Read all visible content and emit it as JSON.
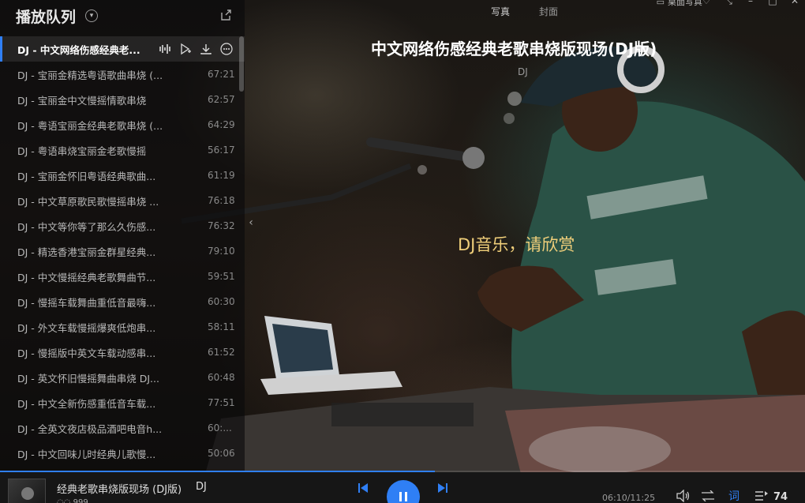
{
  "sidebar": {
    "title": "播放队列",
    "tracks": [
      {
        "title": "DJ - 中文网络伤感经典老...",
        "duration": ""
      },
      {
        "title": "DJ - 宝丽金精选粤语歌曲串烧 (...",
        "duration": "67:21"
      },
      {
        "title": "DJ - 宝丽金中文慢摇情歌串烧",
        "duration": "62:57"
      },
      {
        "title": "DJ - 粤语宝丽金经典老歌串烧 (...",
        "duration": "64:29"
      },
      {
        "title": "DJ - 粤语串烧宝丽金老歌慢摇",
        "duration": "56:17"
      },
      {
        "title": "DJ - 宝丽金怀旧粤语经典歌曲...",
        "duration": "61:19"
      },
      {
        "title": "DJ - 中文草原歌民歌慢摇串烧 ...",
        "duration": "76:18"
      },
      {
        "title": "DJ - 中文等你等了那么久伤感...",
        "duration": "76:32"
      },
      {
        "title": "DJ - 精选香港宝丽金群星经典...",
        "duration": "79:10"
      },
      {
        "title": "DJ - 中文慢摇经典老歌舞曲节...",
        "duration": "59:51"
      },
      {
        "title": "DJ - 慢摇车载舞曲重低音最嗨...",
        "duration": "60:30"
      },
      {
        "title": "DJ - 外文车载慢摇爆爽低炮串...",
        "duration": "58:11"
      },
      {
        "title": "DJ - 慢摇版中英文车载动感串...",
        "duration": "61:52"
      },
      {
        "title": "DJ - 英文怀旧慢摇舞曲串烧 DJ...",
        "duration": "60:48"
      },
      {
        "title": "DJ - 中文全新伤感重低音车载...",
        "duration": "77:51"
      },
      {
        "title": "DJ - 全英文夜店极品酒吧电音h...",
        "duration": "60:..."
      },
      {
        "title": "DJ - 中文回味儿时经典儿歌慢...",
        "duration": "50:06"
      }
    ]
  },
  "topbar": {
    "tabs": [
      "写真",
      "封面"
    ],
    "mode": "桌面写真"
  },
  "now_playing": {
    "title": "中文网络伤感经典老歌串烧版现场(DJ版)",
    "artist": "DJ",
    "lyric": "DJ音乐，请欣赏",
    "bar_title": "经典老歌串烧版现场 (DJ版)",
    "bar_artist": "DJ",
    "bar_meta": "999",
    "time": "06:10/11:25",
    "progress": 0.54,
    "lyrics_btn": "词",
    "queue_count": "74"
  },
  "colors": {
    "accent": "#2f7ff5",
    "lyric": "#f0cf7a"
  }
}
